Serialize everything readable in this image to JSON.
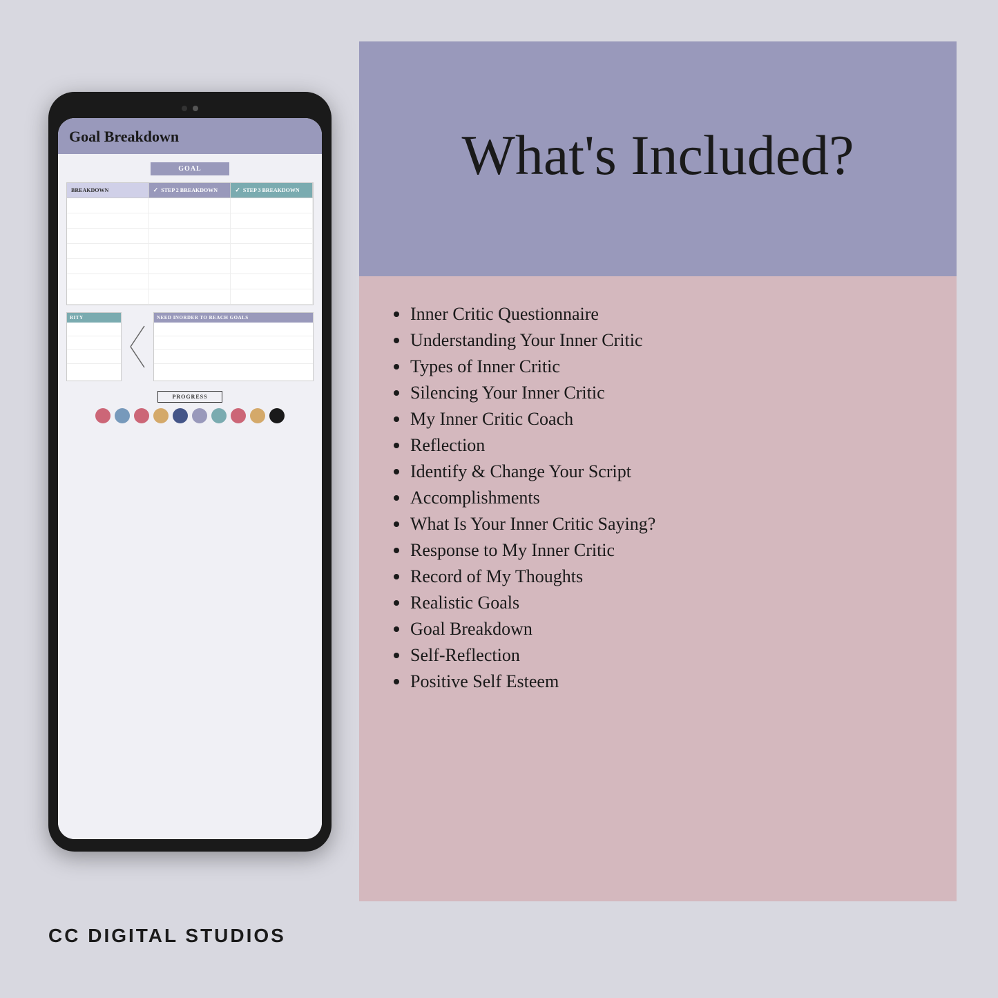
{
  "tablet": {
    "title": "Goal Breakdown",
    "goal_label": "GOAL",
    "step1_header": "BREAKDOWN",
    "step2_header": "STEP 2 BREAKDOWN",
    "step3_header": "STEP 3 BREAKDOWN",
    "bottom_left_label": "RITY",
    "bottom_right_label": "NEED INORDER TO REACH GOALS",
    "progress_label": "PROGRESS",
    "dots": [
      {
        "color": "#cc6677"
      },
      {
        "color": "#7799bb"
      },
      {
        "color": "#cc6677"
      },
      {
        "color": "#d4a96a"
      },
      {
        "color": "#445588"
      },
      {
        "color": "#9999bb"
      },
      {
        "color": "#7aabb0"
      },
      {
        "color": "#cc6677"
      },
      {
        "color": "#d4a96a"
      },
      {
        "color": "#1a1a1a"
      }
    ]
  },
  "header": {
    "title": "What's Included?"
  },
  "list": {
    "items": [
      "Inner Critic Questionnaire",
      "Understanding Your Inner Critic",
      "Types of Inner Critic",
      "Silencing Your Inner Critic",
      "My Inner Critic Coach",
      "Reflection",
      "Identify & Change Your Script",
      "Accomplishments",
      "What Is Your Inner Critic Saying?",
      "Response to My Inner Critic",
      "Record of My Thoughts",
      "Realistic Goals",
      "Goal Breakdown",
      "Self-Reflection",
      "Positive Self Esteem"
    ]
  },
  "footer": {
    "brand": "CC DIGITAL STUDIOS"
  }
}
